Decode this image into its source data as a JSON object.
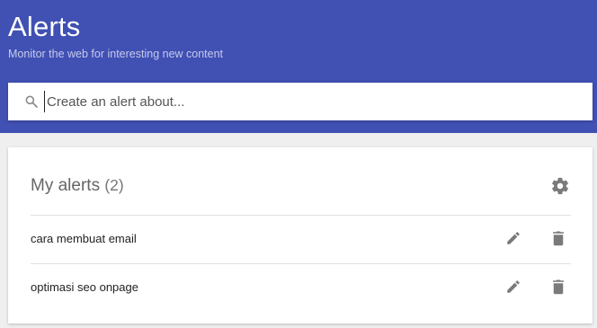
{
  "header": {
    "title": "Alerts",
    "subtitle": "Monitor the web for interesting new content",
    "background": "#4150b3"
  },
  "search": {
    "placeholder": "Create an alert about...",
    "icon": "search-icon"
  },
  "alerts_card": {
    "title": "My alerts",
    "count": "(2)",
    "settings_icon": "gear-icon",
    "items": [
      {
        "label": "cara membuat email",
        "edit_icon": "pencil-icon",
        "delete_icon": "trash-icon"
      },
      {
        "label": "optimasi seo onpage",
        "edit_icon": "pencil-icon",
        "delete_icon": "trash-icon"
      }
    ]
  }
}
